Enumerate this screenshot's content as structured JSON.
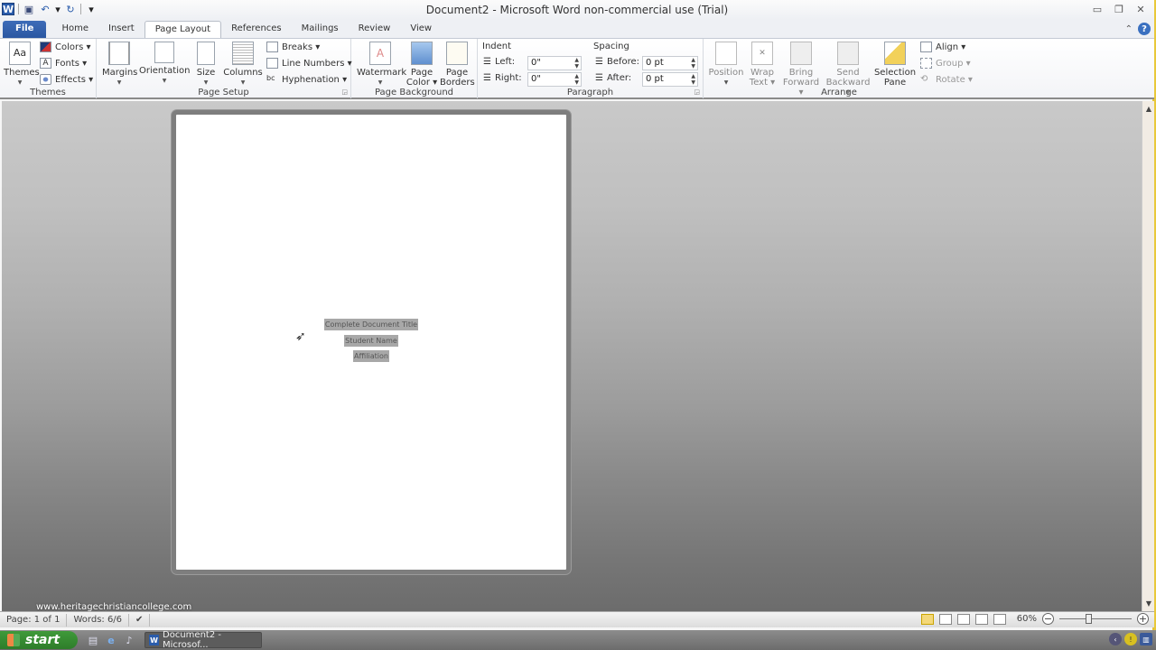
{
  "window": {
    "title": "Document2  -  Microsoft Word non-commercial use (Trial)",
    "controls": {
      "minimize": "▭",
      "restore": "❐",
      "close": "✕"
    }
  },
  "qat": {
    "logo": "W",
    "save_icon": "💾",
    "undo_icon": "↶",
    "undo_dd": "▾",
    "redo_icon": "↻",
    "customize_icon": "▾"
  },
  "tabs": [
    {
      "label": "File"
    },
    {
      "label": "Home"
    },
    {
      "label": "Insert"
    },
    {
      "label": "Page Layout",
      "active": true
    },
    {
      "label": "References"
    },
    {
      "label": "Mailings"
    },
    {
      "label": "Review"
    },
    {
      "label": "View"
    }
  ],
  "ribbon_right": {
    "minimize_ribbon": "⌃",
    "help": "?"
  },
  "ribbon": {
    "themes": {
      "label": "Themes",
      "themes_btn": "Themes",
      "colors": "Colors ▾",
      "fonts": "Fonts ▾",
      "effects": "Effects ▾"
    },
    "page_setup": {
      "label": "Page Setup",
      "margins": "Margins",
      "orientation": "Orientation",
      "size": "Size",
      "columns": "Columns",
      "breaks": "Breaks ▾",
      "line_numbers": "Line Numbers ▾",
      "hyphenation": "Hyphenation ▾"
    },
    "page_background": {
      "label": "Page Background",
      "watermark": "Watermark",
      "page_color_1": "Page",
      "page_color_2": "Color ▾",
      "page_borders_1": "Page",
      "page_borders_2": "Borders"
    },
    "paragraph": {
      "label": "Paragraph",
      "indent_title": "Indent",
      "left_label": "Left:",
      "left_value": "0\"",
      "right_label": "Right:",
      "right_value": "0\"",
      "spacing_title": "Spacing",
      "before_label": "Before:",
      "before_value": "0 pt",
      "after_label": "After:",
      "after_value": "0 pt"
    },
    "arrange": {
      "label": "Arrange",
      "position": "Position",
      "wrap_text_1": "Wrap",
      "wrap_text_2": "Text ▾",
      "bring_forward_1": "Bring",
      "bring_forward_2": "Forward ▾",
      "send_backward_1": "Send",
      "send_backward_2": "Backward ▾",
      "selection_pane_1": "Selection",
      "selection_pane_2": "Pane",
      "align": "Align ▾",
      "group": "Group ▾",
      "rotate": "Rotate ▾"
    }
  },
  "document": {
    "lines": [
      "Complete Document Title",
      "Student Name",
      "Affiliation"
    ]
  },
  "overlay": {
    "url": "www.heritagechristiancollege.com"
  },
  "statusbar": {
    "page": "Page: 1 of 1",
    "words": "Words: 6/6",
    "proofing_icon": "✔",
    "zoom_level": "60%",
    "zoom_fraction": 0.4,
    "zoom_out": "−",
    "zoom_in": "+"
  },
  "taskbar": {
    "start": "start",
    "task_item": "Document2 - Microsof..."
  }
}
